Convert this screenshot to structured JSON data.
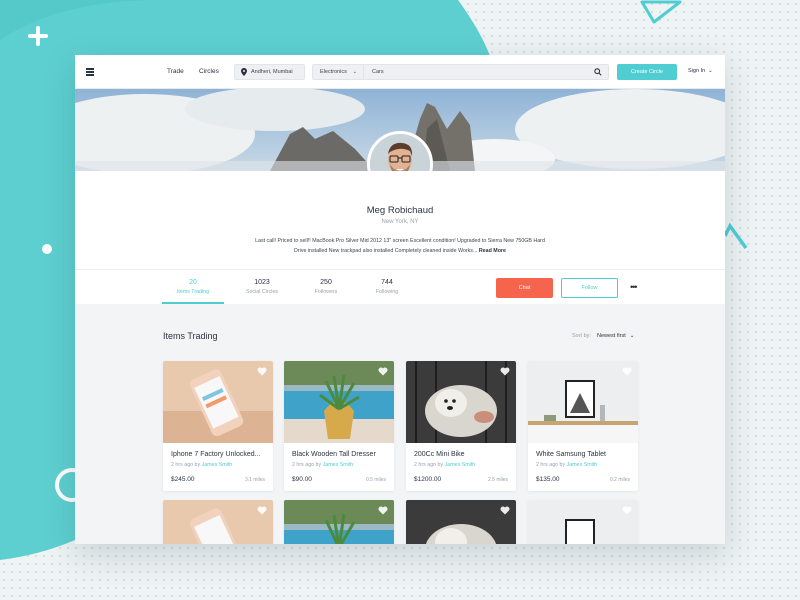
{
  "theme": {
    "accent": "#4fcdd3",
    "chat_color": "#f5654d",
    "backdrop_teal": "#5ecfd0"
  },
  "nav": {
    "menu_icon": "hamburger-icon",
    "links": [
      "Trade",
      "Circles"
    ],
    "location": "Andheri, Mumbai",
    "category": "Electronics",
    "search_value": "Cars",
    "create_label": "Create Circle",
    "signin_label": "Sign In"
  },
  "profile": {
    "name": "Meg Robichaud",
    "location": "New York, NY",
    "bio": "Last call! Priced to sell!! MacBook Pro Silver Mid 2012 13\" screen Excellent condition! Upgraded to Sierra New 750GB Hard Drive installed New trackpad also installed Completely cleaned inside Works...",
    "read_more": "Read More"
  },
  "stats": [
    {
      "num": "20",
      "label": "Items Trading"
    },
    {
      "num": "1023",
      "label": "Social Circles"
    },
    {
      "num": "250",
      "label": "Followers"
    },
    {
      "num": "744",
      "label": "Following"
    }
  ],
  "actions": {
    "chat": "Chat",
    "follow": "Follow",
    "more": "•••"
  },
  "items_section": {
    "title": "Items Trading",
    "sort_label": "Sort by:",
    "sort_value": "Newest first"
  },
  "items": [
    {
      "title": "Iphone 7 Factory Unlocked...",
      "time": "2 hrs ago by",
      "seller": "James Smith",
      "price": "$245.00",
      "distance": "3.1 miles"
    },
    {
      "title": "Black Wooden Tall Dresser",
      "time": "2 hrs ago by",
      "seller": "James Smith",
      "price": "$90.00",
      "distance": "0.5 miles"
    },
    {
      "title": "200Cc Mini Bike",
      "time": "2 hrs ago by",
      "seller": "James Smith",
      "price": "$1200.00",
      "distance": "2.5 miles"
    },
    {
      "title": "White Samsung Tablet",
      "time": "2 hrs ago by",
      "seller": "James Smith",
      "price": "$135.00",
      "distance": "0.2 miles"
    }
  ]
}
